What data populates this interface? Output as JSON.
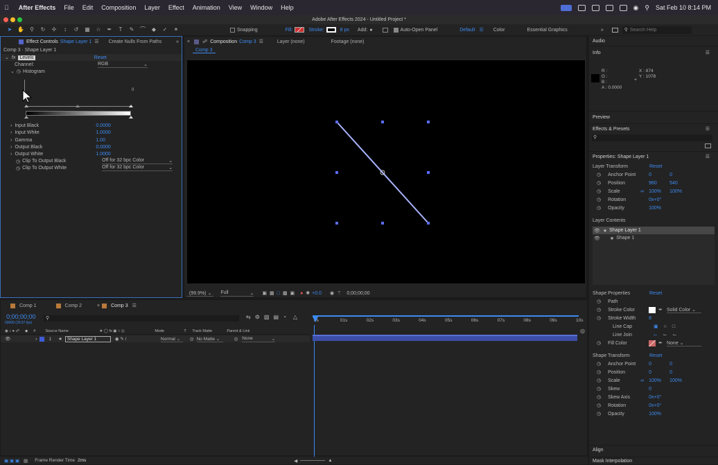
{
  "menubar": {
    "app": "After Effects",
    "items": [
      "File",
      "Edit",
      "Composition",
      "Layer",
      "Effect",
      "Animation",
      "View",
      "Window",
      "Help"
    ],
    "clock": "Sat Feb 10  8:14 PM"
  },
  "titlebar": {
    "title": "Adobe After Effects 2024 - Untitled Project *"
  },
  "toolbar": {
    "snapping": "Snapping",
    "fill": "Fill:",
    "stroke": "Stroke:",
    "stroke_px": "8 px",
    "add": "Add:",
    "auto_open": "Auto-Open Panel",
    "ws_default": "Default",
    "ws_color": "Color",
    "ws_essential": "Essential Graphics",
    "search_placeholder": "Search Help"
  },
  "effect_controls": {
    "tab": "Effect Controls",
    "tab_layer": "Shape Layer 1",
    "tab2": "Create Nulls From Paths",
    "header": "Comp 3 · Shape Layer 1",
    "fx": "fx",
    "effect": "Levels",
    "reset": "Reset",
    "channel_label": "Channel:",
    "channel_value": "RGB",
    "histogram": "Histogram",
    "hist_val": "0",
    "params": [
      {
        "label": "Input Black",
        "value": "0.0000"
      },
      {
        "label": "Input White",
        "value": "1.0000"
      },
      {
        "label": "Gamma",
        "value": "1.00"
      },
      {
        "label": "Output Black",
        "value": "0.0000"
      },
      {
        "label": "Output White",
        "value": "1.0000"
      }
    ],
    "clip": [
      {
        "label": "Clip To Output Black",
        "value": "Off for 32 bpc Color"
      },
      {
        "label": "Clip To Output White",
        "value": "Off for 32 bpc Color"
      }
    ]
  },
  "viewer": {
    "tab": "Composition",
    "tab_comp": "Comp 3",
    "layer": "Layer (none)",
    "footage": "Footage (none)",
    "crumb": "Comp 3",
    "zoom": "(99.9%)",
    "quality": "Full",
    "exposure": "+0.0",
    "timecode": "0;00;00;00",
    "line_color": "#aab4ff"
  },
  "right": {
    "audio": "Audio",
    "info": "Info",
    "r": "R :",
    "g": "G :",
    "b": "B :",
    "a": "A : 0.0000",
    "x": "X : 874",
    "y": "Y : 1078",
    "preview": "Preview",
    "effects_presets": "Effects & Presets",
    "props_title": "Properties: Shape Layer 1",
    "layer_transform": "Layer Transform",
    "reset": "Reset",
    "transform": [
      {
        "label": "Anchor Point",
        "v1": "0",
        "v2": "0"
      },
      {
        "label": "Position",
        "v1": "960",
        "v2": "540"
      },
      {
        "label": "Scale",
        "v1": "100%",
        "v2": "100%"
      },
      {
        "label": "Rotation",
        "v1": "0x+0°",
        "v2": ""
      },
      {
        "label": "Opacity",
        "v1": "100%",
        "v2": ""
      }
    ],
    "layer_contents": "Layer Contents",
    "content_items": [
      "Shape Layer 1",
      "Shape 1"
    ],
    "shape_props": "Shape Properties",
    "path": "Path",
    "stroke_color": "Stroke Color",
    "solid_color": "Solid Color",
    "stroke_width": "Stroke Width",
    "stroke_width_val": "8",
    "line_cap": "Line Cap",
    "line_join": "Line Join",
    "fill_color": "Fill Color",
    "fill_none": "None",
    "shape_transform": "Shape Transform",
    "stransform": [
      {
        "label": "Anchor Point",
        "v1": "0",
        "v2": "0"
      },
      {
        "label": "Position",
        "v1": "0",
        "v2": "0"
      },
      {
        "label": "Scale",
        "v1": "100%",
        "v2": "100%"
      },
      {
        "label": "Skew",
        "v1": "0",
        "v2": ""
      },
      {
        "label": "Skew Axis",
        "v1": "0x+0°",
        "v2": ""
      },
      {
        "label": "Rotation",
        "v1": "0x+0°",
        "v2": ""
      },
      {
        "label": "Opacity",
        "v1": "100%",
        "v2": ""
      }
    ],
    "align": "Align",
    "mask": "Mask Interpolation"
  },
  "timeline": {
    "tabs": [
      "Comp 1",
      "Comp 2",
      "Comp 3"
    ],
    "timecode": "0;00;00;00",
    "fps": "00000 (29.97 fps)",
    "cols": {
      "source": "Source Name",
      "mode": "Mode",
      "t": "T",
      "track": "Track Matte",
      "parent": "Parent & Link"
    },
    "layer": {
      "num": "1",
      "name": "Shape Layer 1",
      "mode": "Normal",
      "matte": "No Matte",
      "parent": "None"
    },
    "ruler": [
      "0s",
      "01s",
      "02s",
      "03s",
      "04s",
      "05s",
      "06s",
      "07s",
      "08s",
      "09s",
      "10s"
    ],
    "footer": "Frame Render Time",
    "footer_val": "2ms"
  }
}
